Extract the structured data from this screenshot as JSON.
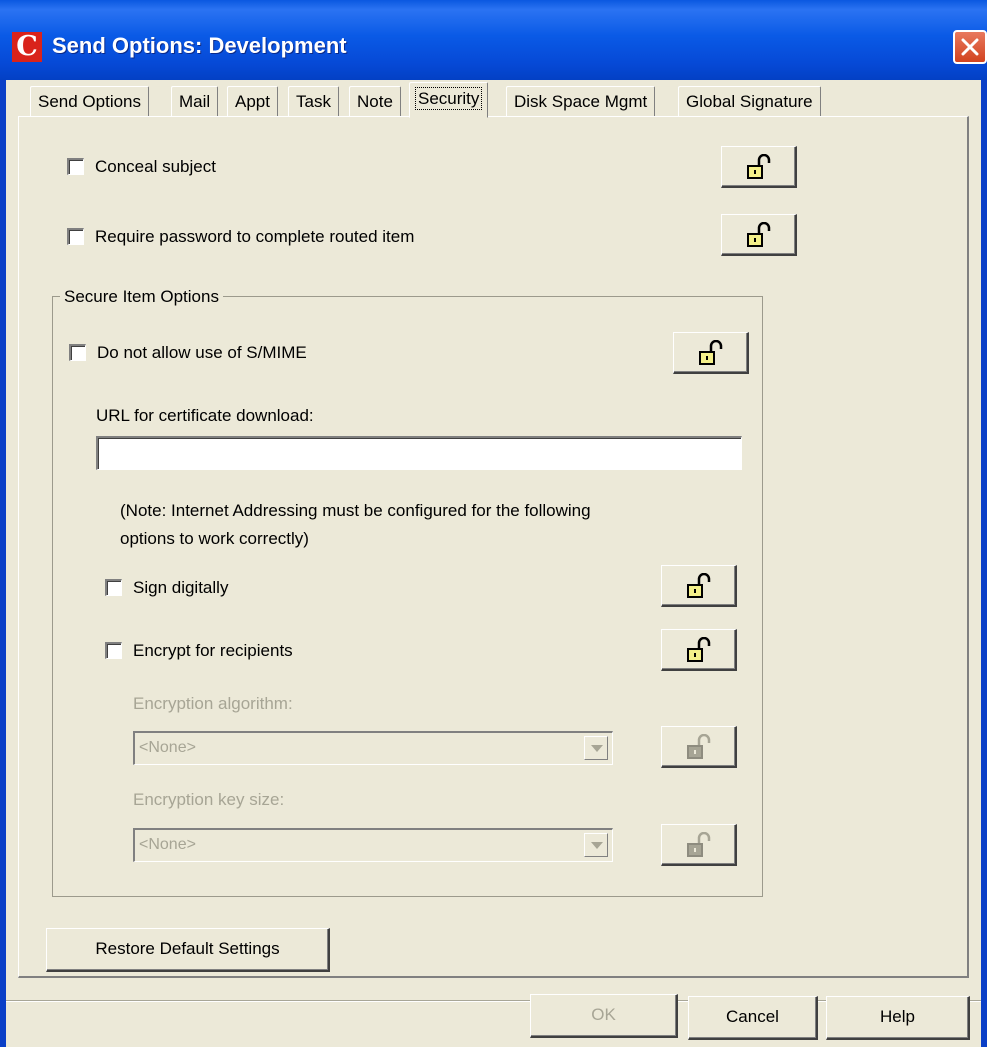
{
  "window": {
    "title": "Send Options:  Development",
    "logo_letter": "C"
  },
  "tabs": [
    {
      "label": "Send Options",
      "active": false
    },
    {
      "label": "Mail",
      "active": false
    },
    {
      "label": "Appt",
      "active": false
    },
    {
      "label": "Task",
      "active": false
    },
    {
      "label": "Note",
      "active": false
    },
    {
      "label": "Security",
      "active": true
    },
    {
      "label": "Disk Space Mgmt",
      "active": false
    },
    {
      "label": "Global Signature",
      "active": false
    }
  ],
  "security": {
    "conceal_subject": {
      "label": "Conceal subject",
      "checked": false
    },
    "require_password": {
      "label": "Require password to complete routed item",
      "checked": false
    },
    "secure_group": {
      "title": "Secure Item Options",
      "no_smime": {
        "label": "Do not allow use of S/MIME",
        "checked": false
      },
      "url_label": "URL for certificate download:",
      "url_value": "",
      "note_line1": "(Note: Internet Addressing must be configured for the following",
      "note_line2": "options to work correctly)",
      "sign_digitally": {
        "label": "Sign digitally",
        "checked": false
      },
      "encrypt": {
        "label": "Encrypt for recipients",
        "checked": false
      },
      "algorithm_label": "Encryption algorithm:",
      "algorithm_value": "<None>",
      "keysize_label": "Encryption key size:",
      "keysize_value": "<None>"
    }
  },
  "buttons": {
    "restore": "Restore Default Settings",
    "ok": "OK",
    "cancel": "Cancel",
    "help": "Help"
  },
  "colors": {
    "titlebar": "#0a5ae6",
    "face": "#ece9d8",
    "lock_yellow": "#f4f08a",
    "disabled_text": "#a7a595"
  }
}
